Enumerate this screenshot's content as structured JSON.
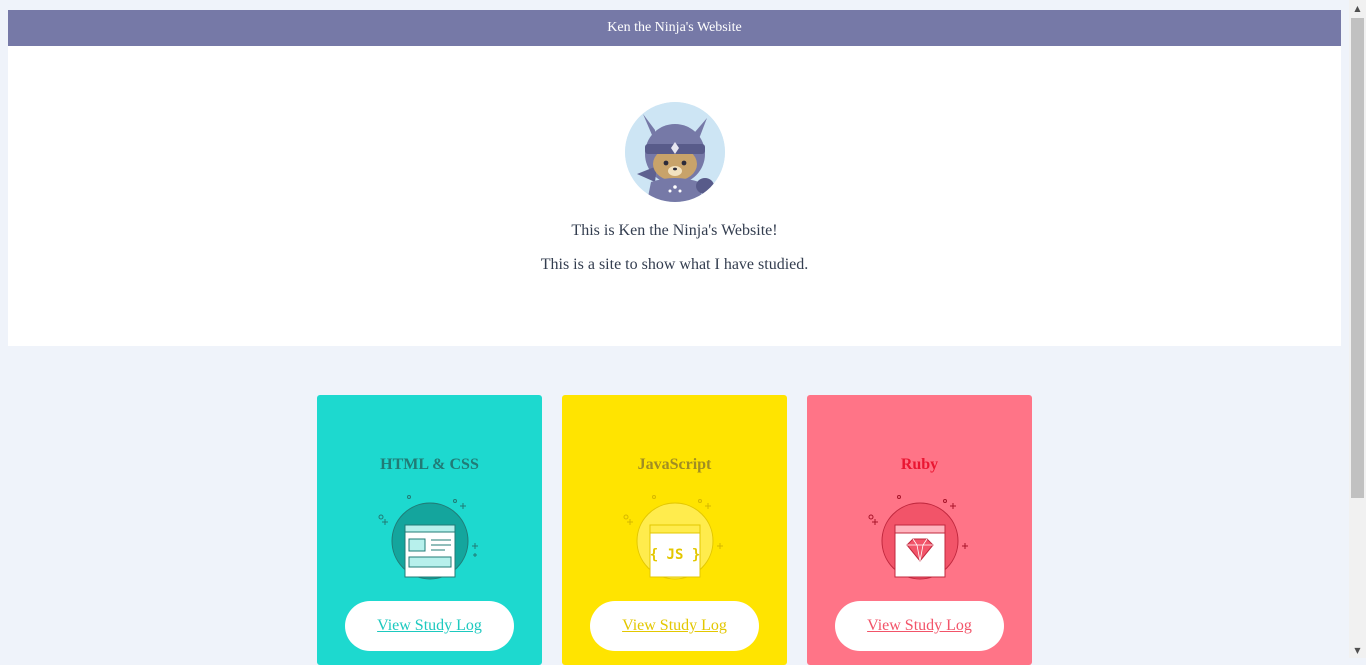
{
  "header": {
    "title": "Ken the Ninja's Website"
  },
  "hero": {
    "avatar_icon": "ninja-cat-icon",
    "line1": "This is Ken the Ninja's Website!",
    "line2": "This is a site to show what I have studied."
  },
  "cards": [
    {
      "title": "HTML & CSS",
      "button": "View Study Log",
      "icon": "html-css-icon",
      "color": "#1dd9cf"
    },
    {
      "title": "JavaScript",
      "button": "View Study Log",
      "icon": "javascript-icon",
      "color": "#ffe400"
    },
    {
      "title": "Ruby",
      "button": "View Study Log",
      "icon": "ruby-gem-icon",
      "color": "#ff7487"
    }
  ],
  "colors": {
    "header": "#7679a7",
    "background": "#eff3fa"
  }
}
